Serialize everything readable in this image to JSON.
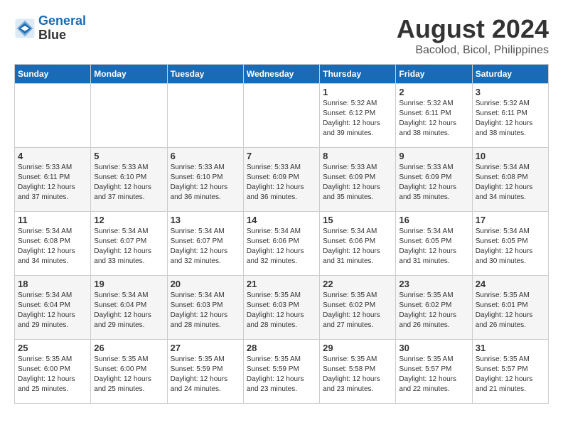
{
  "header": {
    "logo_line1": "General",
    "logo_line2": "Blue",
    "title": "August 2024",
    "subtitle": "Bacolod, Bicol, Philippines"
  },
  "calendar": {
    "days_of_week": [
      "Sunday",
      "Monday",
      "Tuesday",
      "Wednesday",
      "Thursday",
      "Friday",
      "Saturday"
    ],
    "weeks": [
      [
        {
          "day": "",
          "info": ""
        },
        {
          "day": "",
          "info": ""
        },
        {
          "day": "",
          "info": ""
        },
        {
          "day": "",
          "info": ""
        },
        {
          "day": "1",
          "info": "Sunrise: 5:32 AM\nSunset: 6:12 PM\nDaylight: 12 hours\nand 39 minutes."
        },
        {
          "day": "2",
          "info": "Sunrise: 5:32 AM\nSunset: 6:11 PM\nDaylight: 12 hours\nand 38 minutes."
        },
        {
          "day": "3",
          "info": "Sunrise: 5:32 AM\nSunset: 6:11 PM\nDaylight: 12 hours\nand 38 minutes."
        }
      ],
      [
        {
          "day": "4",
          "info": "Sunrise: 5:33 AM\nSunset: 6:11 PM\nDaylight: 12 hours\nand 37 minutes."
        },
        {
          "day": "5",
          "info": "Sunrise: 5:33 AM\nSunset: 6:10 PM\nDaylight: 12 hours\nand 37 minutes."
        },
        {
          "day": "6",
          "info": "Sunrise: 5:33 AM\nSunset: 6:10 PM\nDaylight: 12 hours\nand 36 minutes."
        },
        {
          "day": "7",
          "info": "Sunrise: 5:33 AM\nSunset: 6:09 PM\nDaylight: 12 hours\nand 36 minutes."
        },
        {
          "day": "8",
          "info": "Sunrise: 5:33 AM\nSunset: 6:09 PM\nDaylight: 12 hours\nand 35 minutes."
        },
        {
          "day": "9",
          "info": "Sunrise: 5:33 AM\nSunset: 6:09 PM\nDaylight: 12 hours\nand 35 minutes."
        },
        {
          "day": "10",
          "info": "Sunrise: 5:34 AM\nSunset: 6:08 PM\nDaylight: 12 hours\nand 34 minutes."
        }
      ],
      [
        {
          "day": "11",
          "info": "Sunrise: 5:34 AM\nSunset: 6:08 PM\nDaylight: 12 hours\nand 34 minutes."
        },
        {
          "day": "12",
          "info": "Sunrise: 5:34 AM\nSunset: 6:07 PM\nDaylight: 12 hours\nand 33 minutes."
        },
        {
          "day": "13",
          "info": "Sunrise: 5:34 AM\nSunset: 6:07 PM\nDaylight: 12 hours\nand 32 minutes."
        },
        {
          "day": "14",
          "info": "Sunrise: 5:34 AM\nSunset: 6:06 PM\nDaylight: 12 hours\nand 32 minutes."
        },
        {
          "day": "15",
          "info": "Sunrise: 5:34 AM\nSunset: 6:06 PM\nDaylight: 12 hours\nand 31 minutes."
        },
        {
          "day": "16",
          "info": "Sunrise: 5:34 AM\nSunset: 6:05 PM\nDaylight: 12 hours\nand 31 minutes."
        },
        {
          "day": "17",
          "info": "Sunrise: 5:34 AM\nSunset: 6:05 PM\nDaylight: 12 hours\nand 30 minutes."
        }
      ],
      [
        {
          "day": "18",
          "info": "Sunrise: 5:34 AM\nSunset: 6:04 PM\nDaylight: 12 hours\nand 29 minutes."
        },
        {
          "day": "19",
          "info": "Sunrise: 5:34 AM\nSunset: 6:04 PM\nDaylight: 12 hours\nand 29 minutes."
        },
        {
          "day": "20",
          "info": "Sunrise: 5:34 AM\nSunset: 6:03 PM\nDaylight: 12 hours\nand 28 minutes."
        },
        {
          "day": "21",
          "info": "Sunrise: 5:35 AM\nSunset: 6:03 PM\nDaylight: 12 hours\nand 28 minutes."
        },
        {
          "day": "22",
          "info": "Sunrise: 5:35 AM\nSunset: 6:02 PM\nDaylight: 12 hours\nand 27 minutes."
        },
        {
          "day": "23",
          "info": "Sunrise: 5:35 AM\nSunset: 6:02 PM\nDaylight: 12 hours\nand 26 minutes."
        },
        {
          "day": "24",
          "info": "Sunrise: 5:35 AM\nSunset: 6:01 PM\nDaylight: 12 hours\nand 26 minutes."
        }
      ],
      [
        {
          "day": "25",
          "info": "Sunrise: 5:35 AM\nSunset: 6:00 PM\nDaylight: 12 hours\nand 25 minutes."
        },
        {
          "day": "26",
          "info": "Sunrise: 5:35 AM\nSunset: 6:00 PM\nDaylight: 12 hours\nand 25 minutes."
        },
        {
          "day": "27",
          "info": "Sunrise: 5:35 AM\nSunset: 5:59 PM\nDaylight: 12 hours\nand 24 minutes."
        },
        {
          "day": "28",
          "info": "Sunrise: 5:35 AM\nSunset: 5:59 PM\nDaylight: 12 hours\nand 23 minutes."
        },
        {
          "day": "29",
          "info": "Sunrise: 5:35 AM\nSunset: 5:58 PM\nDaylight: 12 hours\nand 23 minutes."
        },
        {
          "day": "30",
          "info": "Sunrise: 5:35 AM\nSunset: 5:57 PM\nDaylight: 12 hours\nand 22 minutes."
        },
        {
          "day": "31",
          "info": "Sunrise: 5:35 AM\nSunset: 5:57 PM\nDaylight: 12 hours\nand 21 minutes."
        }
      ]
    ]
  }
}
